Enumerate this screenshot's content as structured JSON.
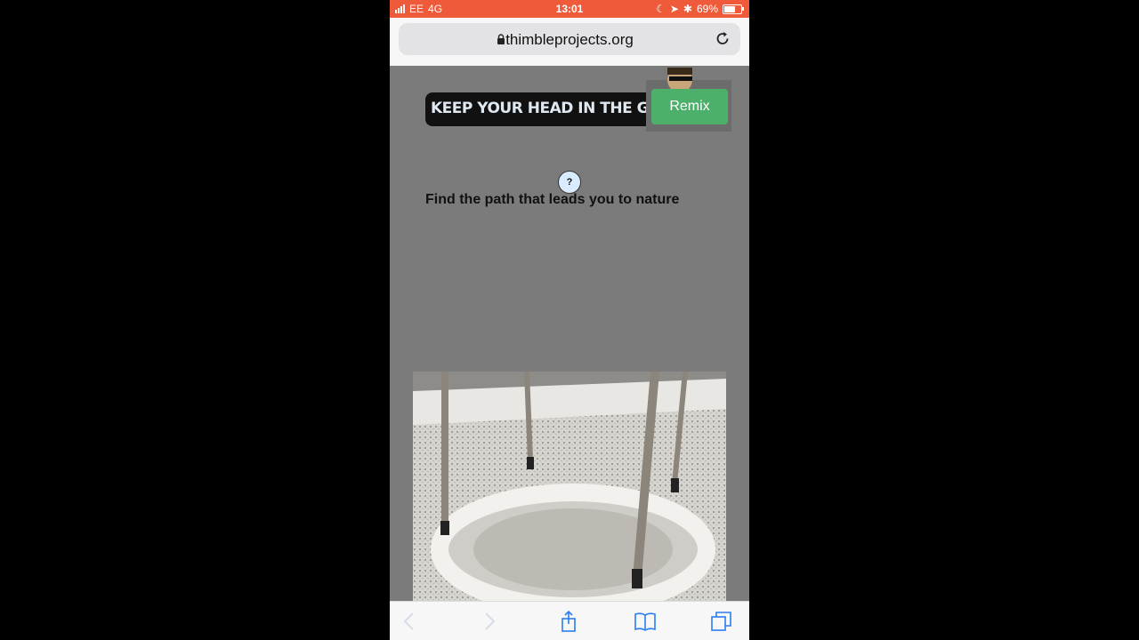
{
  "status_bar": {
    "carrier": "EE",
    "network": "4G",
    "time": "13:01",
    "battery": "69%",
    "battery_level": 0.69
  },
  "browser": {
    "url": "thimbleprojects.org"
  },
  "page": {
    "banner_text": "KEEP YOUR HEAD IN THE GA",
    "remix_label": "Remix",
    "help_label": "?",
    "prompt": "Find the path that leads you to nature"
  },
  "colors": {
    "status_bar": "#ee5a3a",
    "remix": "#4caf6a",
    "page_bg": "#7b7b7b"
  },
  "icons": [
    "lock-icon",
    "reload-icon",
    "back-icon",
    "forward-icon",
    "share-icon",
    "bookmarks-icon",
    "tabs-icon",
    "help-icon"
  ]
}
